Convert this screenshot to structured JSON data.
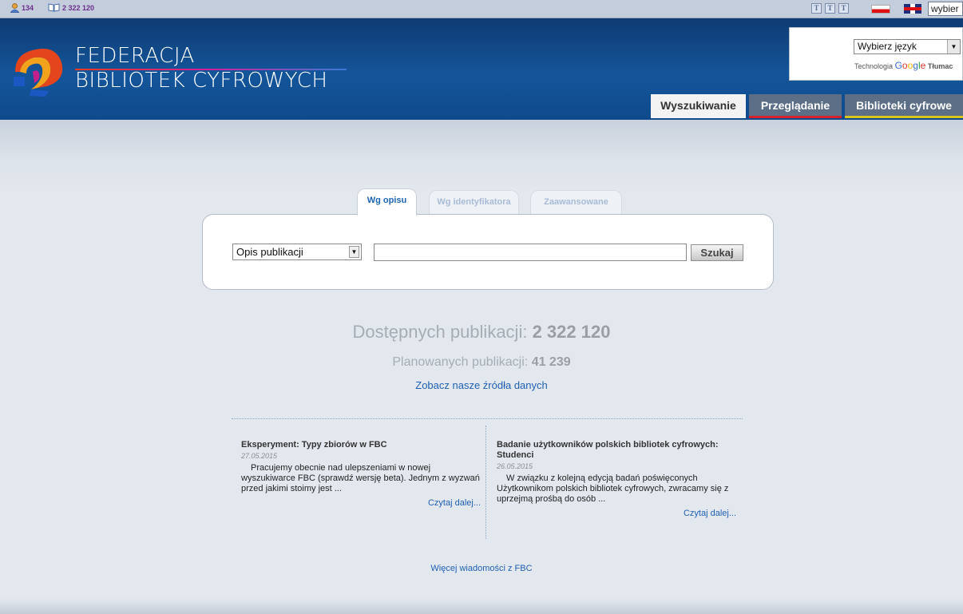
{
  "topbar": {
    "users_count": "134",
    "pubs_count": "2 322 120",
    "font_buttons": [
      "T",
      "T",
      "T"
    ],
    "lang_input_value": "wybier"
  },
  "header": {
    "brand_line1": "FEDERACJA",
    "brand_line2": "BIBLIOTEK CYFROWYCH"
  },
  "translate": {
    "select_value": "Wybierz język",
    "powered_prefix": "Technologia",
    "powered_brand": "Google",
    "powered_suffix": "Tłumac"
  },
  "nav": {
    "tabs": [
      "Wyszukiwanie",
      "Przeglądanie",
      "Biblioteki cyfrowe"
    ]
  },
  "search": {
    "tabs": [
      "Wg opisu",
      "Wg identyfikatora",
      "Zaawansowane"
    ],
    "field_select": "Opis publikacji",
    "query": "",
    "button": "Szukaj"
  },
  "stats": {
    "available_label": "Dostępnych publikacji: ",
    "available_value": "2 322 120",
    "planned_label": "Planowanych publikacji: ",
    "planned_value": "41 239",
    "sources_link": "Zobacz nasze źródła danych"
  },
  "news": [
    {
      "title": "Eksperyment: Typy zbiorów w FBC",
      "date": "27.05.2015",
      "body": "Pracujemy obecnie nad ulepszeniami w nowej wyszukiwarce FBC (sprawdź wersję beta). Jednym z wyzwań przed jakimi stoimy jest ...",
      "more": "Czytaj dalej..."
    },
    {
      "title": "Badanie użytkowników polskich bibliotek cyfrowych: Studenci",
      "date": "26.05.2015",
      "body": "W związku z kolejną edycją badań poświęconych Użytkownikom polskich bibliotek cyfrowych, zwracamy się z uprzejmą prośbą do osób ...",
      "more": "Czytaj dalej..."
    }
  ],
  "more_news": "Więcej wiadomości z FBC",
  "colors": {
    "header_blue": "#14559a",
    "link_blue": "#1f5fb3",
    "tab_browse_accent": "#d5242c",
    "tab_libs_accent": "#d8c61f"
  }
}
